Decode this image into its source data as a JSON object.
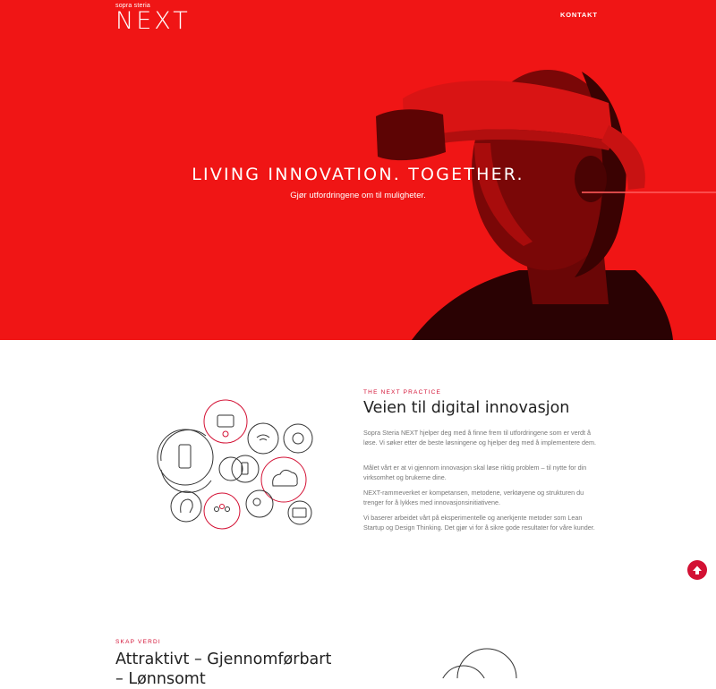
{
  "header": {
    "brand_sub": "sopra steria",
    "brand_logo": "NEXT",
    "nav_contact": "KONTAKT"
  },
  "hero": {
    "title": "LIVING INNOVATION. TOGETHER.",
    "subtitle": "Gjør utfordringene om til muligheter.",
    "background_color": "#f01515"
  },
  "practice": {
    "eyebrow": "THE NEXT PRACTICE",
    "title": "Veien til digital innovasjon",
    "paragraphs": [
      "Sopra Steria NEXT hjelper deg med å finne frem til utfordringene som er verdt å løse. Vi søker etter de beste løsningene og hjelper deg med å implementere dem.",
      "Målet vårt er at vi gjennom innovasjon skal løse riktig problem – til nytte for din virksomhet og brukerne dine.",
      "NEXT-rammeverket er kompetansen, metodene, verktøyene og strukturen du trenger for å lykkes med innovasjonsinitiativene.",
      "Vi baserer arbeidet vårt på eksperimentelle og anerkjente metoder som Lean Startup og Design Thinking. Det gjør vi for å sikre gode resultater for våre kunder."
    ],
    "accent_color": "#d31134"
  },
  "value": {
    "eyebrow": "SKAP VERDI",
    "title": "Attraktivt – Gjennomførbart – Lønnsomt"
  },
  "icons": {
    "scroll_top": "arrow-up-icon"
  }
}
